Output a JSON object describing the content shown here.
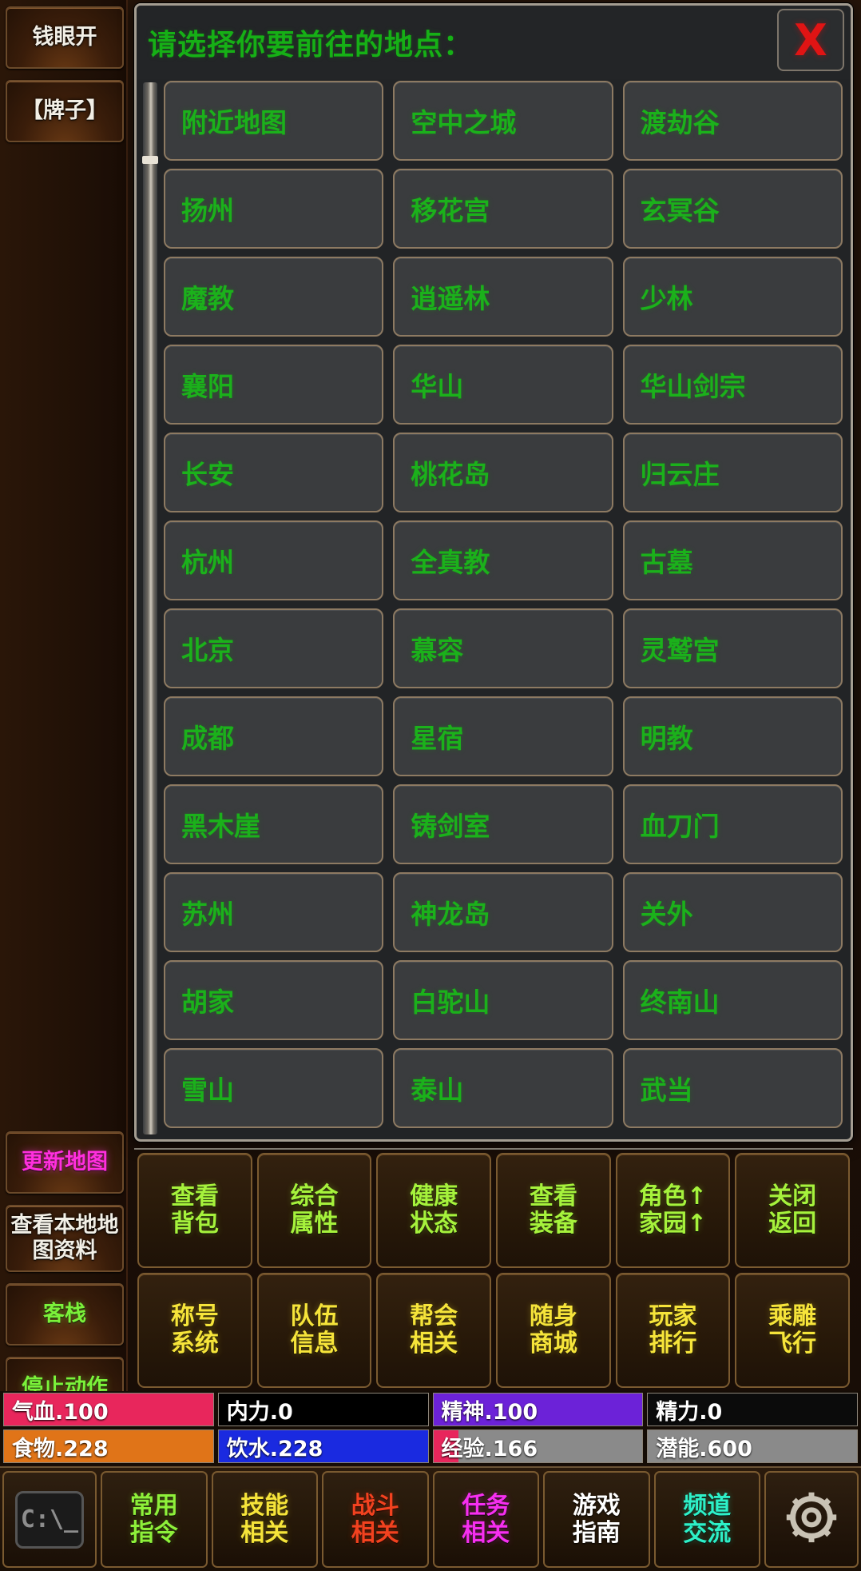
{
  "sidebar": {
    "top_buttons": [
      {
        "label": "钱眼开",
        "color": "white"
      },
      {
        "label": "【牌子】",
        "color": "white"
      }
    ],
    "bottom_buttons": [
      {
        "label": "更新地图",
        "color": "magenta"
      },
      {
        "label": "查看本地地图资料",
        "color": "white"
      },
      {
        "label": "客栈",
        "color": "green"
      },
      {
        "label": "停止动作",
        "color": "green"
      }
    ]
  },
  "dialog": {
    "title": "请选择你要前往的地点：",
    "close_label": "X",
    "locations": [
      "附近地图",
      "空中之城",
      "渡劫谷",
      "扬州",
      "移花宫",
      "玄冥谷",
      "魔教",
      "逍遥林",
      "少林",
      "襄阳",
      "华山",
      "华山剑宗",
      "长安",
      "桃花岛",
      "归云庄",
      "杭州",
      "全真教",
      "古墓",
      "北京",
      "慕容",
      "灵鹫宫",
      "成都",
      "星宿",
      "明教",
      "黑木崖",
      "铸剑室",
      "血刀门",
      "苏州",
      "神龙岛",
      "关外",
      "胡家",
      "白驼山",
      "终南山",
      "雪山",
      "泰山",
      "武当"
    ]
  },
  "actions": {
    "row1": [
      {
        "line1": "查看",
        "line2": "背包"
      },
      {
        "line1": "综合",
        "line2": "属性"
      },
      {
        "line1": "健康",
        "line2": "状态"
      },
      {
        "line1": "查看",
        "line2": "装备"
      },
      {
        "line1": "角色↑",
        "line2": "家园↑"
      },
      {
        "line1": "关闭",
        "line2": "返回"
      }
    ],
    "row2": [
      {
        "line1": "称号",
        "line2": "系统"
      },
      {
        "line1": "队伍",
        "line2": "信息"
      },
      {
        "line1": "帮会",
        "line2": "相关"
      },
      {
        "line1": "随身",
        "line2": "商城"
      },
      {
        "line1": "玩家",
        "line2": "排行"
      },
      {
        "line1": "乘雕",
        "line2": "飞行"
      }
    ]
  },
  "status": {
    "row1": [
      {
        "label": "气血.100",
        "fill_color": "#e8265c",
        "fill_pct": 100,
        "bg_color": "#1a0d0d"
      },
      {
        "label": "内力.0",
        "fill_color": "#000000",
        "fill_pct": 0,
        "bg_color": "#000000"
      },
      {
        "label": "精神.100",
        "fill_color": "#6c22d8",
        "fill_pct": 100,
        "bg_color": "#1a0d2a"
      },
      {
        "label": "精力.0",
        "fill_color": "#000000",
        "fill_pct": 0,
        "bg_color": "#0b0b0b"
      }
    ],
    "row2": [
      {
        "label": "食物.228",
        "fill_color": "#e07418",
        "fill_pct": 100,
        "bg_color": "#2a1606"
      },
      {
        "label": "饮水.228",
        "fill_color": "#1a2ae0",
        "fill_pct": 100,
        "bg_color": "#0d1130"
      },
      {
        "label": "经验.166",
        "fill_color": "#e8265c",
        "fill_pct": 12,
        "bg_color": "#8a8a8a"
      },
      {
        "label": "潜能.600",
        "fill_color": "#8a8a8a",
        "fill_pct": 100,
        "bg_color": "#8a8a8a"
      }
    ]
  },
  "toolbar": {
    "console_icon_label": "C:\\_",
    "buttons": [
      {
        "line1": "常用",
        "line2": "指令",
        "color": "green"
      },
      {
        "line1": "技能",
        "line2": "相关",
        "color": "yellow"
      },
      {
        "line1": "战斗",
        "line2": "相关",
        "color": "red"
      },
      {
        "line1": "任务",
        "line2": "相关",
        "color": "magenta"
      },
      {
        "line1": "游戏",
        "line2": "指南",
        "color": "white"
      },
      {
        "line1": "频道",
        "line2": "交流",
        "color": "cyan"
      }
    ]
  },
  "colors": {
    "location_text": "#1bb11b",
    "dialog_bg": "#222426",
    "close_red": "#e01414"
  }
}
